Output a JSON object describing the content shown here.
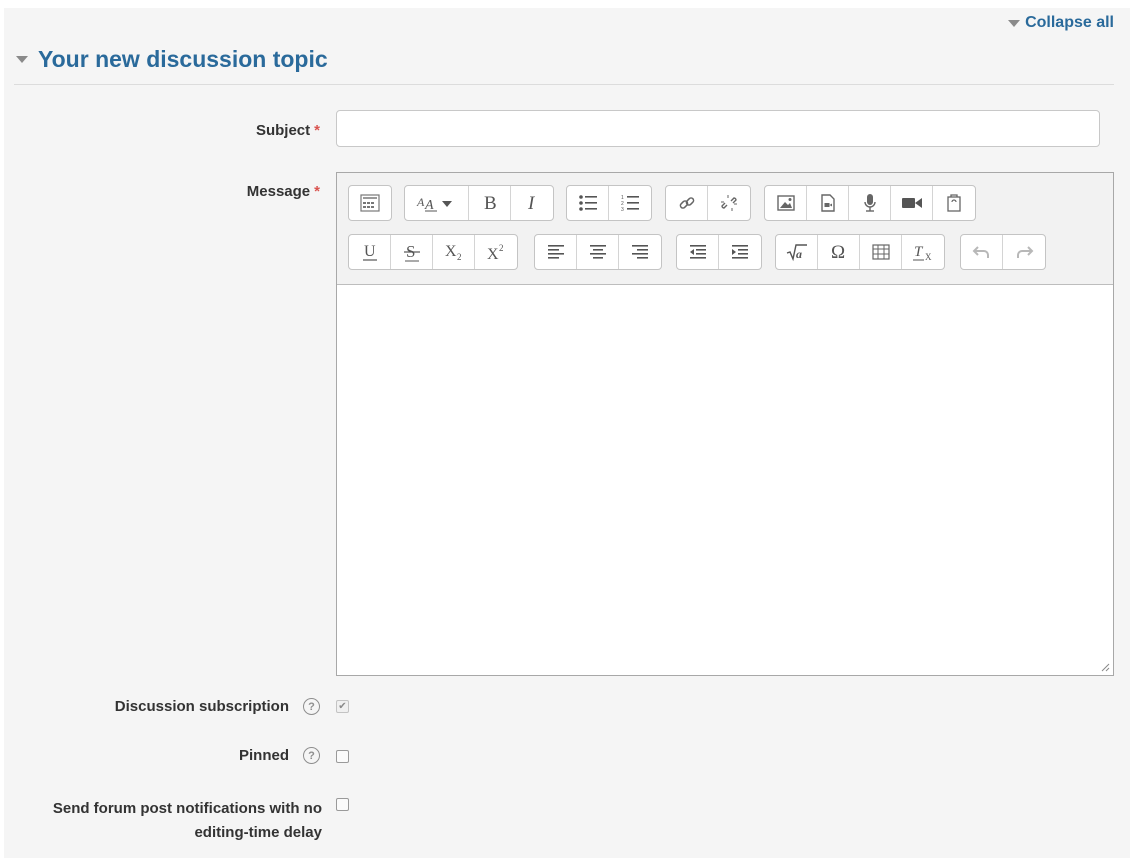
{
  "header": {
    "collapse_all_label": "Collapse all",
    "section_title": "Your new discussion topic"
  },
  "form": {
    "subject": {
      "label": "Subject",
      "value": "",
      "required_marker": "*"
    },
    "message": {
      "label": "Message",
      "required_marker": "*",
      "value": ""
    },
    "discussion_subscription": {
      "label": "Discussion subscription",
      "checked": true,
      "disabled": true
    },
    "pinned": {
      "label": "Pinned",
      "checked": false
    },
    "send_no_delay": {
      "label_line1": "Send forum post notifications with no",
      "label_line2": "editing-time delay",
      "checked": false
    }
  },
  "toolbar": {
    "row1": [
      [
        "toolbar-toggle-icon"
      ],
      [
        "font-style-icon",
        "bold-icon",
        "italic-icon"
      ],
      [
        "unordered-list-icon",
        "ordered-list-icon"
      ],
      [
        "link-icon",
        "unlink-icon"
      ],
      [
        "image-icon",
        "media-icon",
        "record-audio-icon",
        "record-video-icon",
        "manage-files-icon"
      ]
    ],
    "row2": [
      [
        "underline-icon",
        "strikethrough-icon",
        "subscript-icon",
        "superscript-icon"
      ],
      [
        "align-left-icon",
        "align-center-icon",
        "align-right-icon"
      ],
      [
        "outdent-icon",
        "indent-icon"
      ],
      [
        "equation-icon",
        "special-character-icon",
        "table-icon",
        "clear-formatting-icon"
      ],
      [
        "undo-icon",
        "redo-icon"
      ]
    ]
  },
  "colors": {
    "link": "#2a6a9b",
    "required": "#d9534f",
    "panel_bg": "#f5f5f5"
  }
}
